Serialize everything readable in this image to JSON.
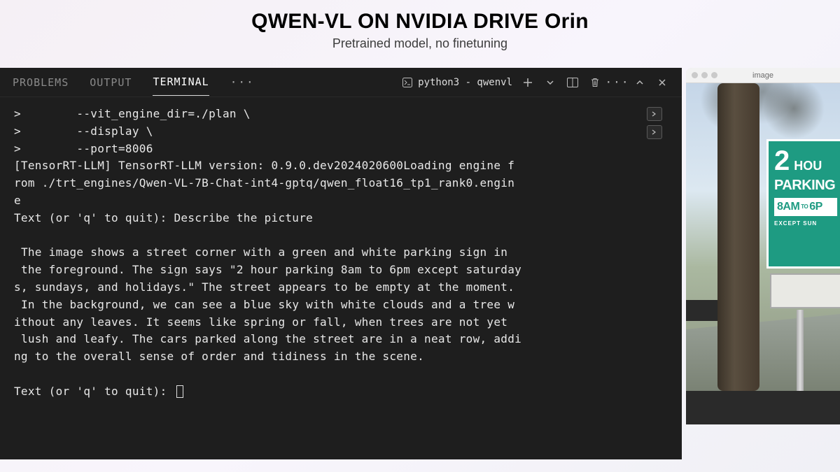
{
  "header": {
    "title": "QWEN-VL ON NVIDIA DRIVE Orin",
    "subtitle": "Pretrained model, no finetuning"
  },
  "editor": {
    "tabs": {
      "problems": "PROBLEMS",
      "output": "OUTPUT",
      "terminal": "TERMINAL"
    },
    "terminal_label": "python3 - qwenvl"
  },
  "terminal": {
    "lines": ">        --vit_engine_dir=./plan \\\n>        --display \\\n>        --port=8006\n[TensorRT-LLM] TensorRT-LLM version: 0.9.0.dev2024020600Loading engine f\nrom ./trt_engines/Qwen-VL-7B-Chat-int4-gptq/qwen_float16_tp1_rank0.engin\ne\nText (or 'q' to quit): Describe the picture\n\n The image shows a street corner with a green and white parking sign in\n the foreground. The sign says \"2 hour parking 8am to 6pm except saturday\ns, sundays, and holidays.\" The street appears to be empty at the moment.\n In the background, we can see a blue sky with white clouds and a tree w\nithout any leaves. It seems like spring or fall, when trees are not yet\n lush and leafy. The cars parked along the street are in a neat row, addi\nng to the overall sense of order and tidiness in the scene.\n\nText (or 'q' to quit): "
  },
  "image_window": {
    "title": "image"
  },
  "sign": {
    "big_number": "2",
    "hour": "HOU",
    "parking": "PARKING",
    "time_from": "8AM",
    "time_to_word": "TO",
    "time_to": "6P",
    "except": "EXCEPT SUN"
  }
}
